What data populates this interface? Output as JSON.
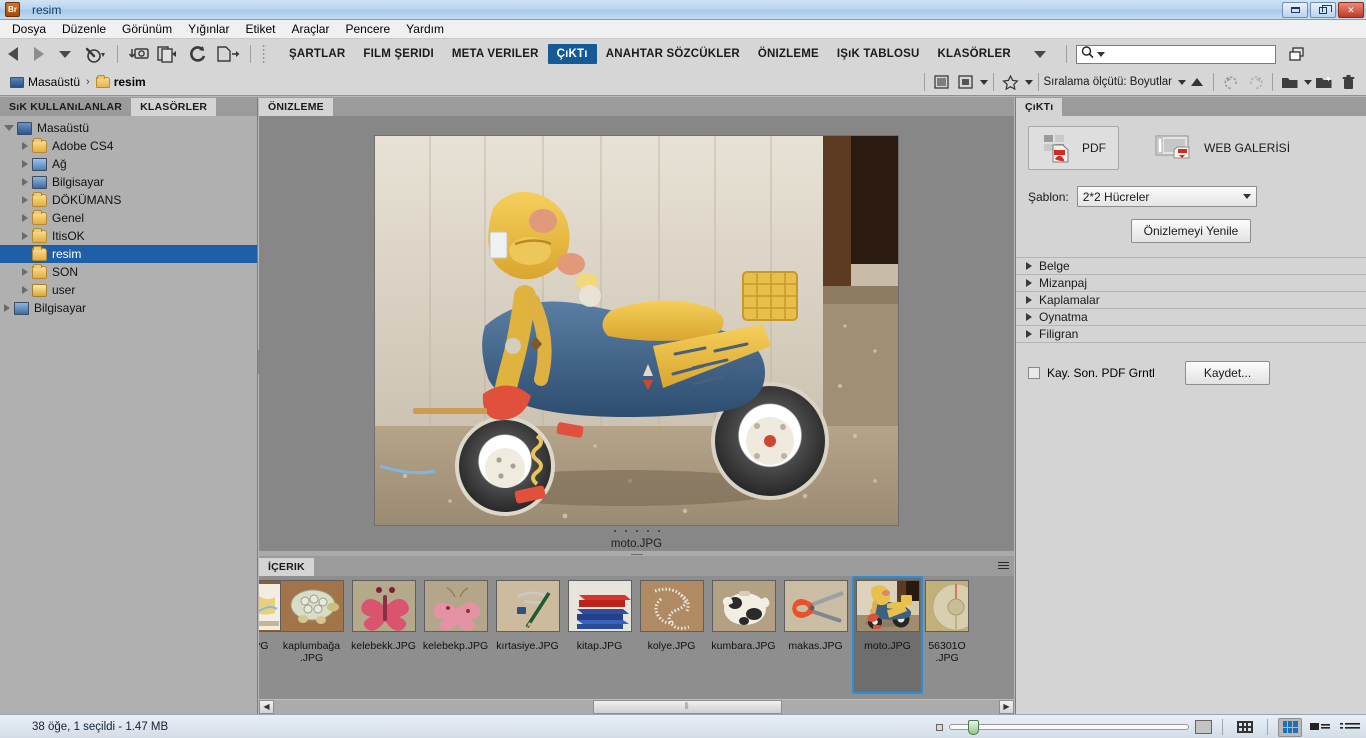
{
  "window": {
    "app_badge": "Br",
    "title": "resim",
    "buttons": {
      "minimize": "minimize-icon",
      "maximize": "maximize-icon",
      "close": "close-icon"
    }
  },
  "menubar": {
    "items": [
      "Dosya",
      "Düzenle",
      "Görünüm",
      "Yığınlar",
      "Etiket",
      "Araçlar",
      "Pencere",
      "Yardım"
    ]
  },
  "toolbar": {
    "nav": [
      "back-arrow-icon",
      "forward-arrow-icon",
      "history-dropdown-icon",
      "recent-folders-icon"
    ],
    "actions": [
      "get-photos-from-camera-icon",
      "refine-icon",
      "rotate-icon",
      "new-file-icon"
    ],
    "workspaces": [
      {
        "label": "ŞARTLAR",
        "active": false
      },
      {
        "label": "FILM ŞERIDI",
        "active": false
      },
      {
        "label": "META VERILER",
        "active": false
      },
      {
        "label": "ÇıKTı",
        "active": true
      },
      {
        "label": "ANAHTAR SÖZCÜKLER",
        "active": false
      },
      {
        "label": "ÖNIZLEME",
        "active": false
      },
      {
        "label": "IŞıK TABLOSU",
        "active": false
      },
      {
        "label": "KLASÖRLER",
        "active": false
      }
    ],
    "workspace_more": "chevron-down-icon",
    "search_placeholder": ""
  },
  "pathbar": {
    "crumbs": [
      {
        "label": "Masaüstü",
        "icon": "monitor-icon"
      },
      {
        "label": "resim",
        "icon": "folder-icon"
      }
    ],
    "separator": "›",
    "sort_label": "Sıralama ölçütü: Boyutlar",
    "icons": [
      "filter-icon",
      "filter-grid-icon",
      "star-filter-icon",
      "sort-ascending-icon",
      "undo-icon",
      "redo-icon",
      "new-folder-icon",
      "new-subfolder-icon",
      "delete-icon"
    ]
  },
  "left_panel": {
    "tabs": [
      {
        "label": "SıK KULLANıLANLAR",
        "active": false
      },
      {
        "label": "KLASÖRLER",
        "active": true
      }
    ],
    "tree": [
      {
        "label": "Masaüstü",
        "indent": 0,
        "icon": "monitor-icon",
        "twisty": "open",
        "selected": false
      },
      {
        "label": "Adobe CS4",
        "indent": 1,
        "icon": "folder-icon",
        "twisty": "closed",
        "selected": false
      },
      {
        "label": "Ağ",
        "indent": 1,
        "icon": "network-icon",
        "twisty": "closed",
        "selected": false
      },
      {
        "label": "Bilgisayar",
        "indent": 1,
        "icon": "computer-icon",
        "twisty": "closed",
        "selected": false
      },
      {
        "label": "DÖKÜMANS",
        "indent": 1,
        "icon": "folder-icon",
        "twisty": "closed",
        "selected": false
      },
      {
        "label": "Genel",
        "indent": 1,
        "icon": "folder-icon",
        "twisty": "closed",
        "selected": false
      },
      {
        "label": "ItisOK",
        "indent": 1,
        "icon": "folder-icon",
        "twisty": "closed",
        "selected": false
      },
      {
        "label": "resim",
        "indent": 1,
        "icon": "folder-icon",
        "twisty": "none",
        "selected": true
      },
      {
        "label": "SON",
        "indent": 1,
        "icon": "folder-icon",
        "twisty": "closed",
        "selected": false
      },
      {
        "label": "user",
        "indent": 1,
        "icon": "user-folder-icon",
        "twisty": "closed",
        "selected": false
      },
      {
        "label": "Bilgisayar",
        "indent": 0,
        "icon": "computer-icon",
        "twisty": "closed",
        "selected": false
      }
    ]
  },
  "preview_panel": {
    "tab": "ÖNIZLEME",
    "filename": "moto.JPG",
    "rating_dots": 5
  },
  "content_panel": {
    "tab": "İÇERIK",
    "flyout": "panel-menu-icon",
    "thumbnails": [
      {
        "label": "a.JPG",
        "kind": "map",
        "selected": false,
        "partial": true
      },
      {
        "label": "kaplumbağa\n.JPG",
        "kind": "turtle",
        "selected": false
      },
      {
        "label": "kelebekk.JPG",
        "kind": "butterfly-red",
        "selected": false
      },
      {
        "label": "kelebekp.JPG",
        "kind": "butterfly-pink",
        "selected": false
      },
      {
        "label": "kırtasiye.JPG",
        "kind": "stationery",
        "selected": false
      },
      {
        "label": "kitap.JPG",
        "kind": "books",
        "selected": false
      },
      {
        "label": "kolye.JPG",
        "kind": "necklace",
        "selected": false
      },
      {
        "label": "kumbara.JPG",
        "kind": "piggybank",
        "selected": false
      },
      {
        "label": "makas.JPG",
        "kind": "scissors",
        "selected": false
      },
      {
        "label": "moto.JPG",
        "kind": "moto",
        "selected": true
      },
      {
        "label": "56301O\n.JPG",
        "kind": "cd",
        "selected": false,
        "partial": true
      }
    ],
    "scrollbar": {
      "left_arrow": "◀",
      "right_arrow": "▶",
      "grip": "⦀"
    }
  },
  "right_panel": {
    "tab": "ÇıKTı",
    "output_buttons": [
      {
        "label": "PDF",
        "icon": "pdf-icon",
        "active": true
      },
      {
        "label": "WEB GALERİSİ",
        "icon": "web-gallery-icon",
        "active": false
      }
    ],
    "template_label": "Şablon:",
    "template_value": "2*2 Hücreler",
    "template_caret": "chevron-down-icon",
    "refresh_button": "Önizlemeyi Yenile",
    "sections": [
      "Belge",
      "Mizanpaj",
      "Kaplamalar",
      "Oynatma",
      "Filigran"
    ],
    "checkbox_label": "Kay. Son. PDF Grntl",
    "checkbox_checked": false,
    "save_button": "Kaydet..."
  },
  "statusbar": {
    "text": "38 öğe, 1 seçildi - 1.47 MB",
    "zoom_small_icon": "small-thumbnail-icon",
    "zoom_large_icon": "large-thumbnail-icon",
    "view_modes": [
      {
        "name": "grid-lock-view",
        "active": false
      },
      {
        "name": "thumbnail-view",
        "active": true
      },
      {
        "name": "details-view",
        "active": false
      },
      {
        "name": "list-view",
        "active": false
      }
    ]
  },
  "colors": {
    "accent_blue": "#135a97",
    "selection_blue": "#1f5fa8",
    "thumb_selection": "#2a8fd8",
    "panel_gray": "#d4d4d4",
    "content_gray": "#8e8e8e"
  }
}
